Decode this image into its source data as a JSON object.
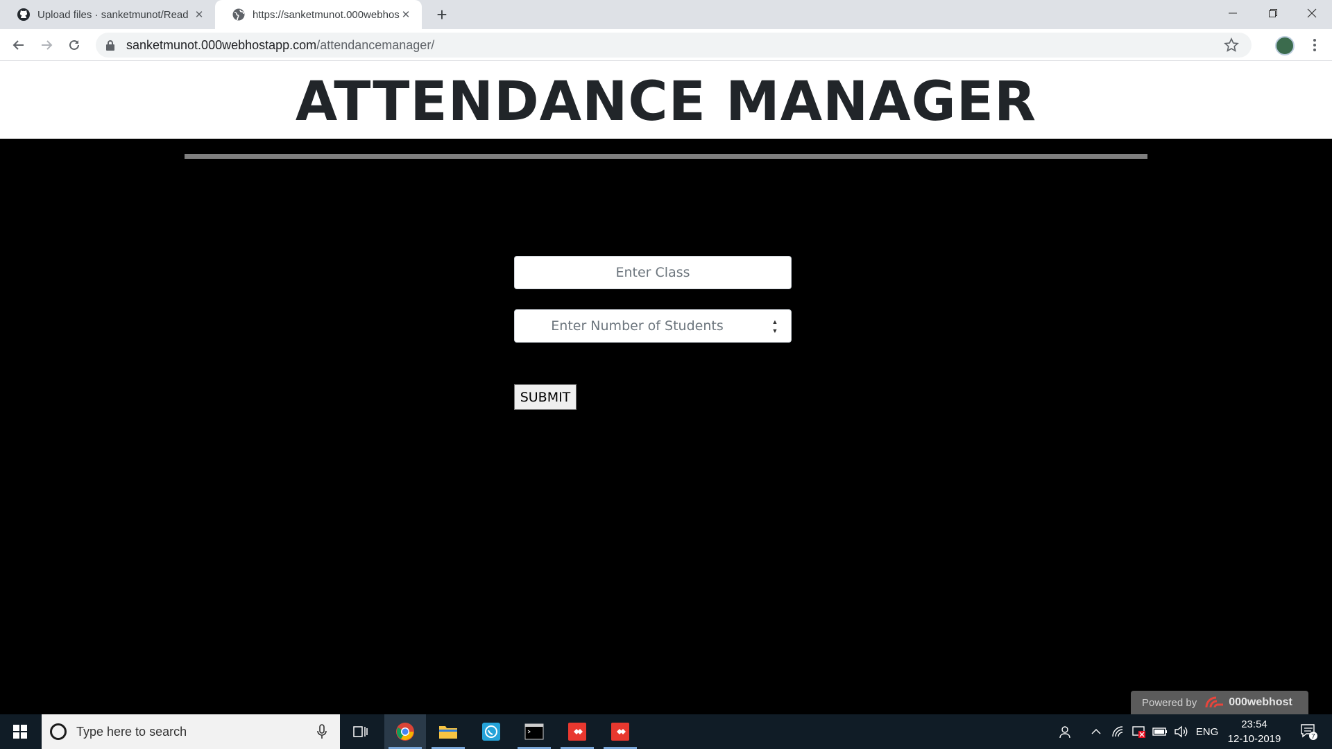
{
  "browser": {
    "tabs": [
      {
        "title": "Upload files · sanketmunot/Read",
        "icon": "github-icon"
      },
      {
        "title": "https://sanketmunot.000webhost",
        "icon": "globe-icon"
      }
    ],
    "url_host": "sanketmunot.000webhostapp.com",
    "url_path": "/attendancemanager/"
  },
  "page": {
    "title": "ATTENDANCE MANAGER",
    "class_placeholder": "Enter Class",
    "students_placeholder": "Enter Number of Students",
    "submit_label": "SUBMIT",
    "powered_by": "Powered by",
    "powered_brand": "000webhost"
  },
  "taskbar": {
    "search_placeholder": "Type here to search",
    "language": "ENG",
    "time": "23:54",
    "date": "12-10-2019",
    "notification_count": "7"
  },
  "colors": {
    "page_background": "#000000",
    "header_background": "#ffffff",
    "title_color": "#212529",
    "divider": "#7f7f7f",
    "taskbar": "#101c26"
  }
}
